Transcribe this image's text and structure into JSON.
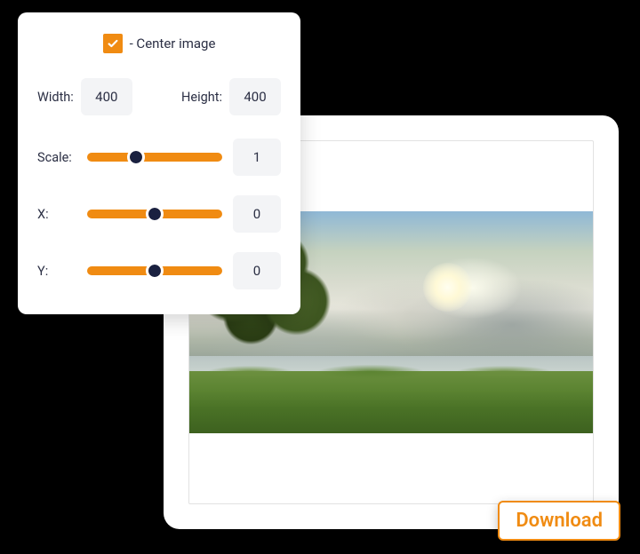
{
  "controls": {
    "center_checkbox": {
      "checked": true,
      "label": "- Center image"
    },
    "width": {
      "label": "Width:",
      "value": "400"
    },
    "height": {
      "label": "Height:",
      "value": "400"
    },
    "scale": {
      "label": "Scale:",
      "value": "1",
      "thumb_pct": 36
    },
    "x": {
      "label": "X:",
      "value": "0",
      "thumb_pct": 50
    },
    "y": {
      "label": "Y:",
      "value": "0",
      "thumb_pct": 50
    }
  },
  "download": {
    "label": "Download"
  },
  "colors": {
    "accent": "#f08b12"
  }
}
